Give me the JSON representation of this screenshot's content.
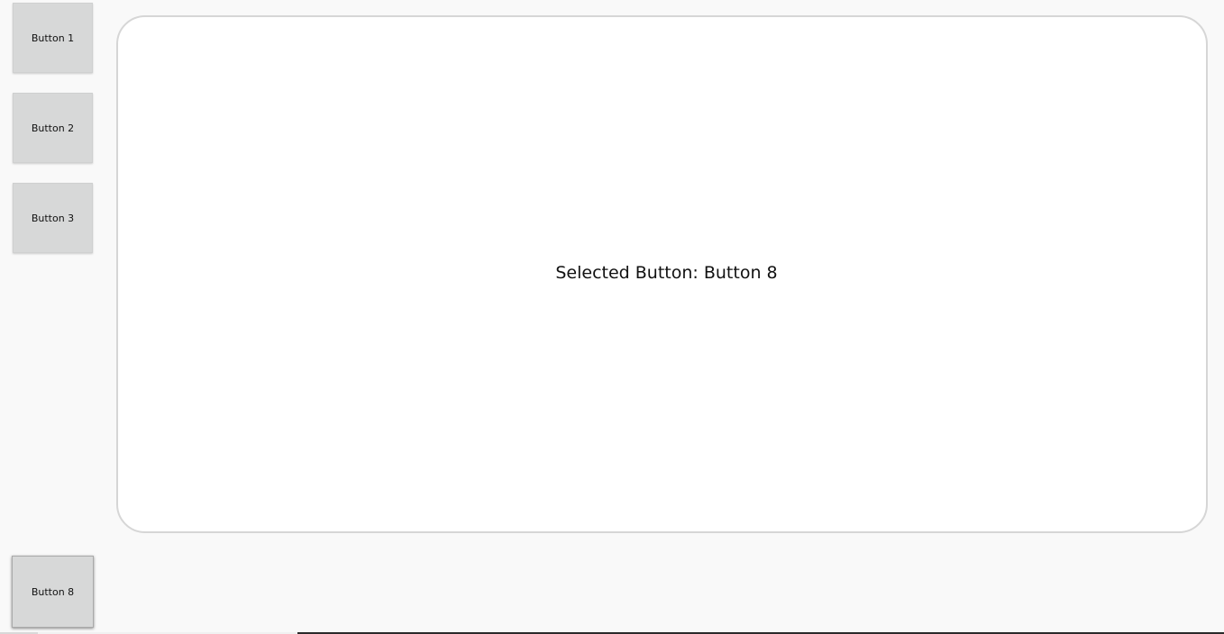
{
  "sidebar": {
    "buttons": [
      {
        "label": "Button 1"
      },
      {
        "label": "Button 2"
      },
      {
        "label": "Button 3"
      },
      {
        "label": "Button 8"
      }
    ]
  },
  "main": {
    "selected_text": "Selected Button: Button 8"
  },
  "colors": {
    "background": "#f9f9f9",
    "button": "#d7d8d8",
    "panel": "#ffffff",
    "panel_border": "#d6d6d6"
  }
}
